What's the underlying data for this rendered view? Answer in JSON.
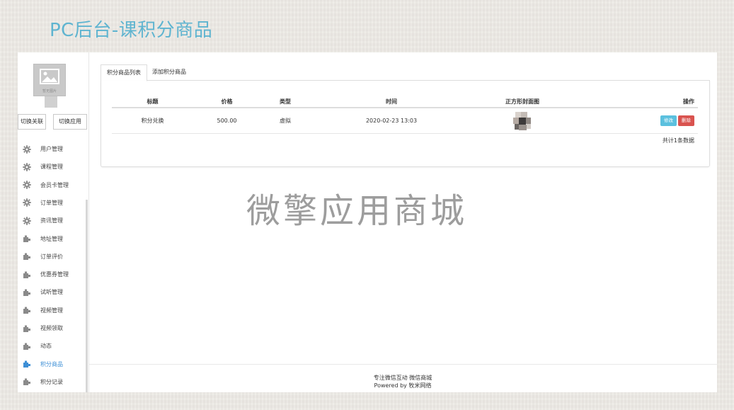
{
  "page": {
    "title": "PC后台-课积分商品"
  },
  "sidebar": {
    "avatar_caption": "暂无图片",
    "switch_related": "切换关联",
    "switch_app": "切换应用",
    "items": [
      {
        "label": "用户管理",
        "icon": "gear-icon"
      },
      {
        "label": "课程管理",
        "icon": "gear-icon"
      },
      {
        "label": "会员卡管理",
        "icon": "gear-icon"
      },
      {
        "label": "订单管理",
        "icon": "gear-icon"
      },
      {
        "label": "资讯管理",
        "icon": "gear-icon"
      },
      {
        "label": "地址管理",
        "icon": "puzzle-icon"
      },
      {
        "label": "订单评价",
        "icon": "puzzle-icon"
      },
      {
        "label": "优惠券管理",
        "icon": "puzzle-icon"
      },
      {
        "label": "试听管理",
        "icon": "puzzle-icon"
      },
      {
        "label": "视频管理",
        "icon": "puzzle-icon"
      },
      {
        "label": "视频领取",
        "icon": "puzzle-icon"
      },
      {
        "label": "动态",
        "icon": "puzzle-icon"
      },
      {
        "label": "积分商品",
        "icon": "puzzle-icon",
        "active": true
      },
      {
        "label": "积分记录",
        "icon": "puzzle-icon"
      }
    ],
    "active_color": "#3d8fd6"
  },
  "tabs": [
    {
      "label": "积分商品列表",
      "active": true
    },
    {
      "label": "添加积分商品",
      "active": false
    }
  ],
  "table": {
    "columns": [
      "标题",
      "价格",
      "类型",
      "时间",
      "正方形封面图",
      "操作"
    ],
    "rows": [
      {
        "title": "积分兑换",
        "price": "500.00",
        "type": "虚拟",
        "time": "2020-02-23 13:03",
        "cover": "blurred-image"
      }
    ],
    "edit_label": "修改",
    "delete_label": "删除",
    "total": "共计1条数据"
  },
  "watermark": "微擎应用商城",
  "footer": {
    "line1": "专注微信互动 微信商城",
    "line2": "Powered by 牧米网络"
  },
  "colors": {
    "title": "#5fb4d0",
    "edit_button": "#5bc0de",
    "delete_button": "#d9534f"
  }
}
